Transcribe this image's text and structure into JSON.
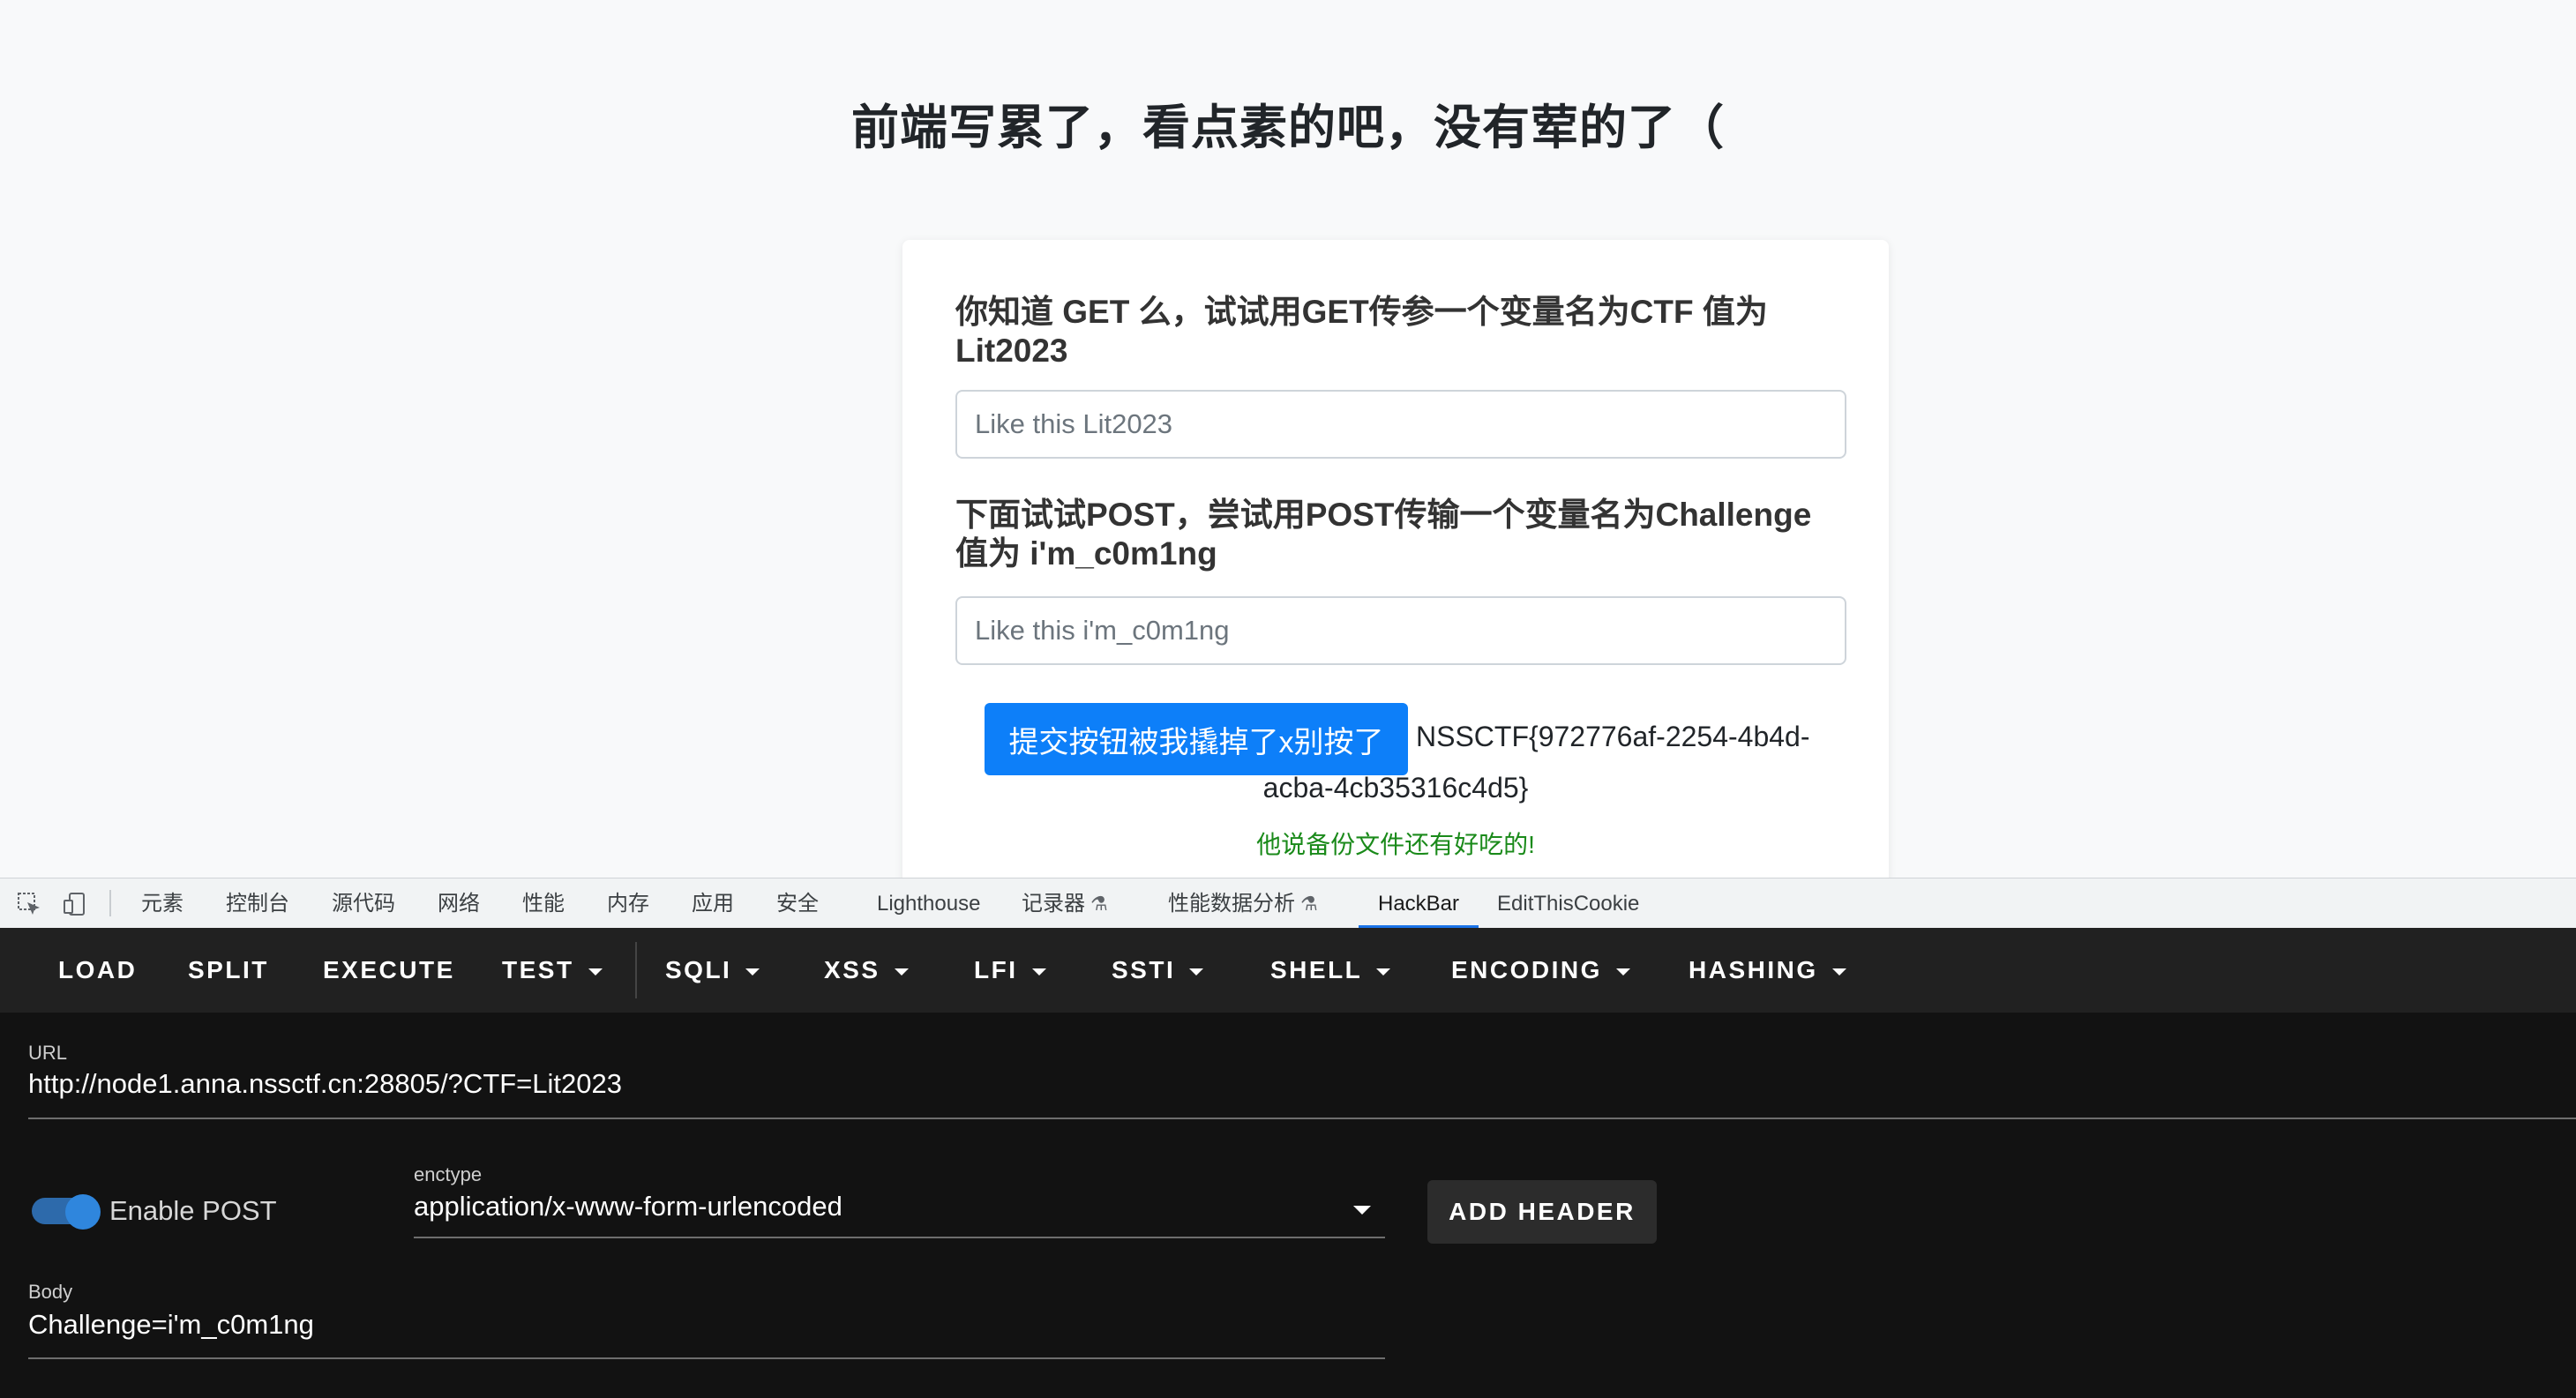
{
  "page": {
    "title": "前端写累了，看点素的吧，没有荤的了（",
    "get_question": "你知道 GET 么，试试用GET传参一个变量名为CTF 值为 Lit2023",
    "get_placeholder": "Like this Lit2023",
    "post_question": "下面试试POST，尝试用POST传输一个变量名为Challenge 值为 i'm_c0m1ng",
    "post_placeholder": "Like this i'm_c0m1ng",
    "submit_label": "提交按钮被我撬掉了x别按了",
    "flag_part1": "NSSCTF{972776af-2254-4b4d-",
    "flag_part2": "acba-4cb35316c4d5}",
    "hint": "他说备份文件还有好吃的!"
  },
  "devtools": {
    "tabs": [
      {
        "label": "元素"
      },
      {
        "label": "控制台"
      },
      {
        "label": "源代码"
      },
      {
        "label": "网络"
      },
      {
        "label": "性能"
      },
      {
        "label": "内存"
      },
      {
        "label": "应用"
      },
      {
        "label": "安全"
      },
      {
        "label": "Lighthouse"
      },
      {
        "label": "记录器"
      },
      {
        "label": "性能数据分析"
      },
      {
        "label": "HackBar"
      },
      {
        "label": "EditThisCookie"
      }
    ],
    "active_tab": "HackBar",
    "accent_color": "#1a73e8"
  },
  "hackbar": {
    "toolbar": [
      {
        "label": "LOAD"
      },
      {
        "label": "SPLIT"
      },
      {
        "label": "EXECUTE"
      },
      {
        "label": "TEST"
      },
      {
        "label": "SQLI"
      },
      {
        "label": "XSS"
      },
      {
        "label": "LFI"
      },
      {
        "label": "SSTI"
      },
      {
        "label": "SHELL"
      },
      {
        "label": "ENCODING"
      },
      {
        "label": "HASHING"
      }
    ],
    "url_label": "URL",
    "url_value": "http://node1.anna.nssctf.cn:28805/?CTF=Lit2023",
    "enable_post_label": "Enable POST",
    "enable_post_on": true,
    "enctype_label": "enctype",
    "enctype_value": "application/x-www-form-urlencoded",
    "add_header_label": "ADD HEADER",
    "body_label": "Body",
    "body_value": "Challenge=i'm_c0m1ng"
  },
  "colors": {
    "primary_button": "#0d7ff9",
    "hint_green": "#1a8a1a",
    "toggle_blue": "#2f86dd",
    "hackbar_bg": "#121212"
  }
}
